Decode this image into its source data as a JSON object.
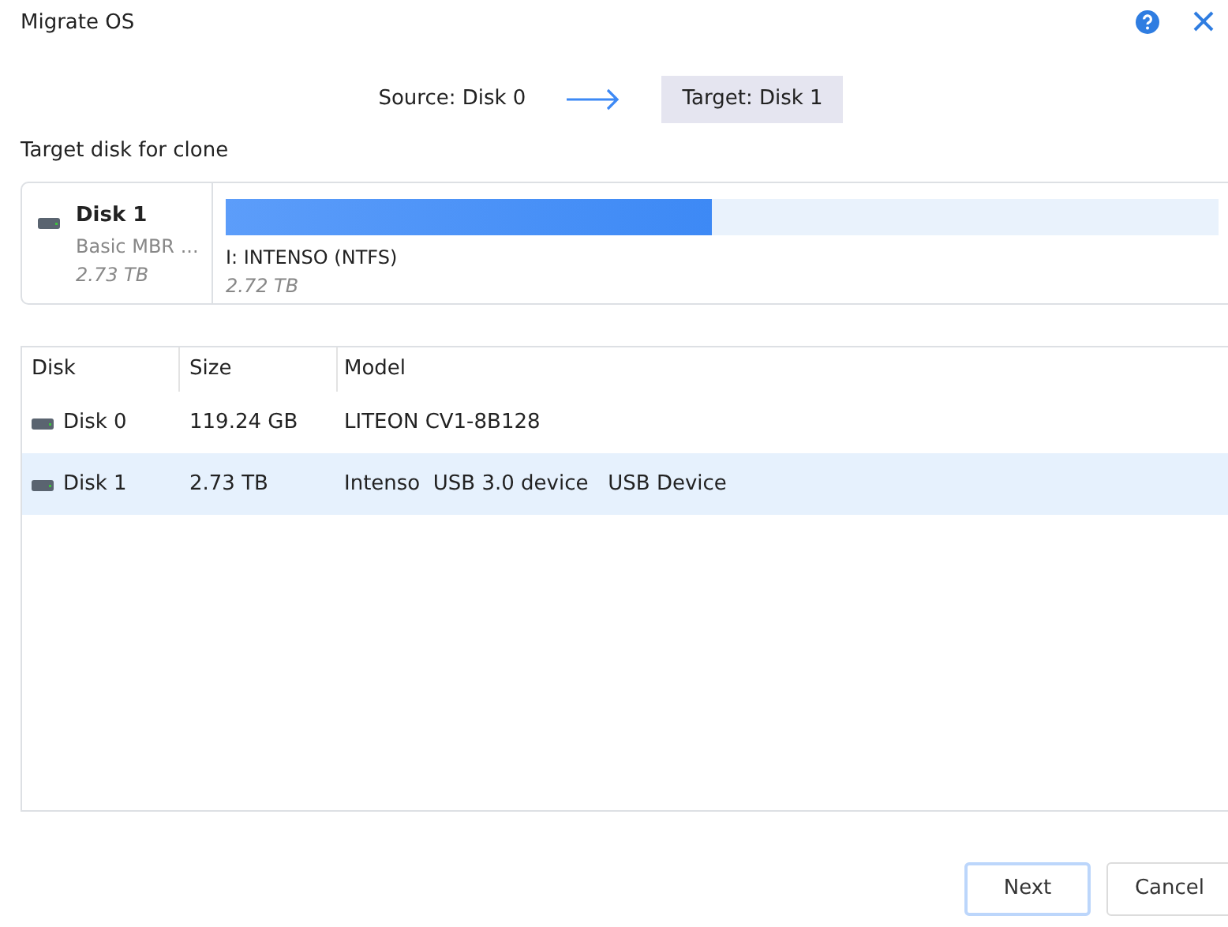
{
  "window": {
    "title": "Migrate OS"
  },
  "steps": {
    "source": "Source: Disk 0",
    "target": "Target: Disk 1"
  },
  "section_label": "Target disk for clone",
  "target_disk": {
    "name": "Disk 1",
    "type": "Basic MBR ...",
    "size": "2.73 TB",
    "partition": {
      "label": "I: INTENSO (NTFS)",
      "size": "2.72 TB",
      "level": 0.49
    }
  },
  "table": {
    "columns": [
      "Disk",
      "Size",
      "Model"
    ],
    "rows": [
      {
        "cells": [
          "Disk 0",
          "119.24 GB",
          "LITEON CV1-8B128"
        ],
        "selected": false
      },
      {
        "cells": [
          "Disk 1",
          "2.73 TB",
          "Intenso  USB 3.0 device   USB Device"
        ],
        "selected": true
      }
    ]
  },
  "buttons": [
    {
      "label": "Next",
      "kind": "primary"
    },
    {
      "label": "Cancel",
      "kind": "secondary"
    }
  ]
}
